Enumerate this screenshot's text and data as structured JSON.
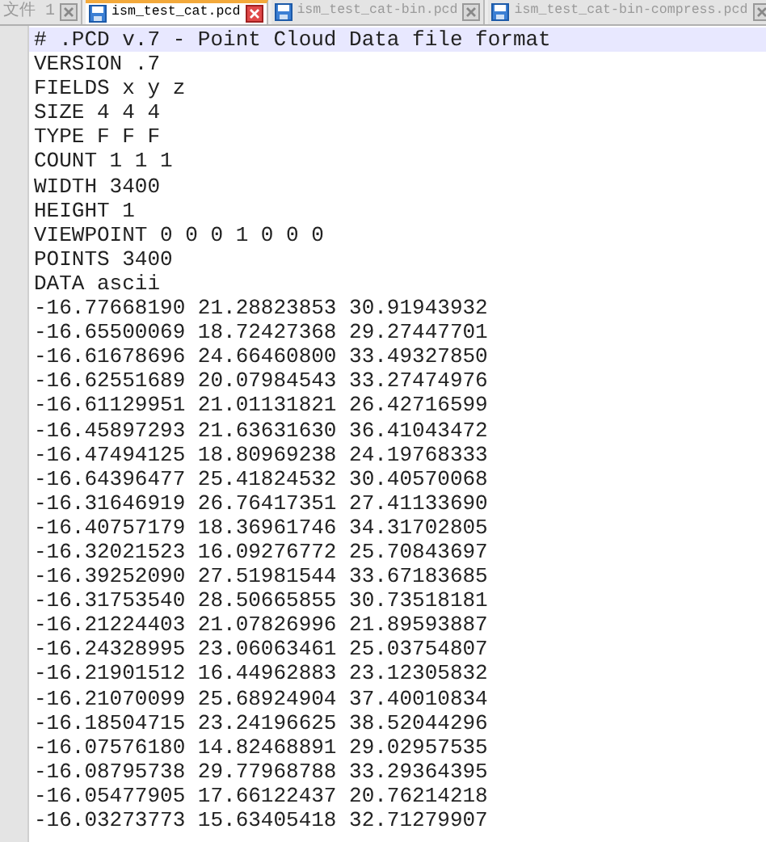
{
  "tabs": [
    {
      "label": "文件 1",
      "selected": false,
      "kind": "plain"
    },
    {
      "label": "ism_test_cat.pcd",
      "selected": true,
      "kind": "file"
    },
    {
      "label": "ism_test_cat-bin.pcd",
      "selected": false,
      "kind": "file"
    },
    {
      "label": "ism_test_cat-bin-compress.pcd",
      "selected": false,
      "kind": "file"
    }
  ],
  "lines": [
    {
      "text": "# .PCD v.7 - Point Cloud Data file format",
      "current": true
    },
    {
      "text": "VERSION .7",
      "current": false
    },
    {
      "text": "FIELDS x y z",
      "current": false
    },
    {
      "text": "SIZE 4 4 4",
      "current": false
    },
    {
      "text": "TYPE F F F",
      "current": false
    },
    {
      "text": "COUNT 1 1 1",
      "current": false
    },
    {
      "text": "WIDTH 3400",
      "current": false
    },
    {
      "text": "HEIGHT 1",
      "current": false
    },
    {
      "text": "VIEWPOINT 0 0 0 1 0 0 0",
      "current": false
    },
    {
      "text": "POINTS 3400",
      "current": false
    },
    {
      "text": "DATA ascii",
      "current": false
    },
    {
      "text": "-16.77668190 21.28823853 30.91943932",
      "current": false
    },
    {
      "text": "-16.65500069 18.72427368 29.27447701",
      "current": false
    },
    {
      "text": "-16.61678696 24.66460800 33.49327850",
      "current": false
    },
    {
      "text": "-16.62551689 20.07984543 33.27474976",
      "current": false
    },
    {
      "text": "-16.61129951 21.01131821 26.42716599",
      "current": false
    },
    {
      "text": "-16.45897293 21.63631630 36.41043472",
      "current": false
    },
    {
      "text": "-16.47494125 18.80969238 24.19768333",
      "current": false
    },
    {
      "text": "-16.64396477 25.41824532 30.40570068",
      "current": false
    },
    {
      "text": "-16.31646919 26.76417351 27.41133690",
      "current": false
    },
    {
      "text": "-16.40757179 18.36961746 34.31702805",
      "current": false
    },
    {
      "text": "-16.32021523 16.09276772 25.70843697",
      "current": false
    },
    {
      "text": "-16.39252090 27.51981544 33.67183685",
      "current": false
    },
    {
      "text": "-16.31753540 28.50665855 30.73518181",
      "current": false
    },
    {
      "text": "-16.21224403 21.07826996 21.89593887",
      "current": false
    },
    {
      "text": "-16.24328995 23.06063461 25.03754807",
      "current": false
    },
    {
      "text": "-16.21901512 16.44962883 23.12305832",
      "current": false
    },
    {
      "text": "-16.21070099 25.68924904 37.40010834",
      "current": false
    },
    {
      "text": "-16.18504715 23.24196625 38.52044296",
      "current": false
    },
    {
      "text": "-16.07576180 14.82468891 29.02957535",
      "current": false
    },
    {
      "text": "-16.08795738 29.77968788 33.29364395",
      "current": false
    },
    {
      "text": "-16.05477905 17.66122437 20.76214218",
      "current": false
    },
    {
      "text": "-16.03273773 15.63405418 32.71279907",
      "current": false
    }
  ]
}
